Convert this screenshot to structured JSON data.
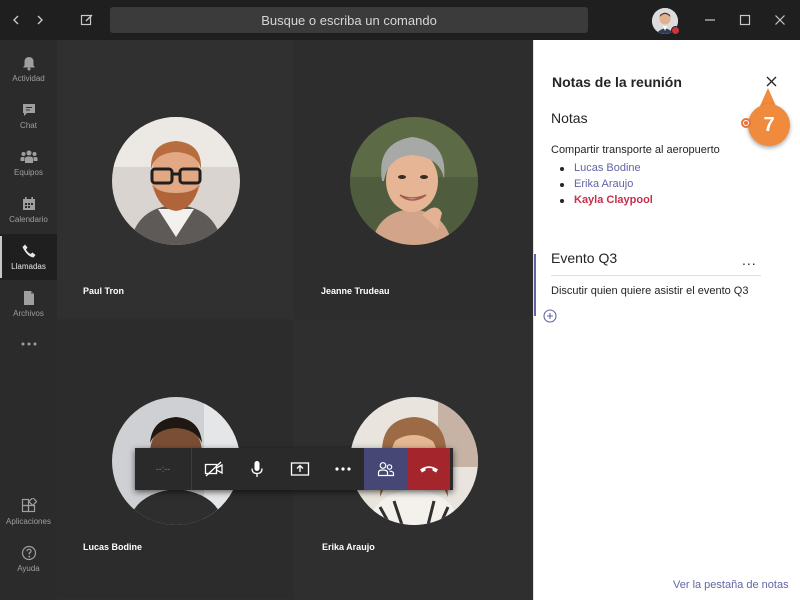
{
  "titlebar": {
    "search_placeholder": "Busque o escriba un comando",
    "back_icon": "chevron-left-icon",
    "forward_icon": "chevron-right-icon",
    "compose_icon": "compose-icon",
    "presence_color": "#d13438"
  },
  "rail": {
    "items": [
      {
        "label": "Actividad",
        "icon": "bell-icon"
      },
      {
        "label": "Chat",
        "icon": "chat-icon"
      },
      {
        "label": "Equipos",
        "icon": "teams-icon"
      },
      {
        "label": "Calendario",
        "icon": "calendar-icon"
      },
      {
        "label": "Llamadas",
        "icon": "phone-icon",
        "active": true
      },
      {
        "label": "Archivos",
        "icon": "file-icon"
      },
      {
        "label": "",
        "icon": "more-icon"
      },
      {
        "label": "Aplicaciones",
        "icon": "apps-icon"
      },
      {
        "label": "Ayuda",
        "icon": "help-icon"
      }
    ]
  },
  "participants": [
    {
      "name": "Paul Tron"
    },
    {
      "name": "Jeanne Trudeau"
    },
    {
      "name": "Lucas Bodine"
    },
    {
      "name": "Erika Araujo"
    }
  ],
  "controls": {
    "timer": "--:--",
    "buttons": [
      "video-off-icon",
      "mic-icon",
      "share-screen-icon",
      "more-icon",
      "participants-icon",
      "hang-up-icon"
    ],
    "hangup_color": "#a4262c",
    "people_color": "#464775"
  },
  "panel": {
    "title": "Notas de la reunión",
    "section1": {
      "heading": "Notas",
      "line": "Compartir transporte al aeropuerto",
      "bullets": [
        "Lucas Bodine",
        "Erika Araujo",
        "Kayla Claypool"
      ]
    },
    "section2": {
      "heading": "Evento Q3",
      "more": "...",
      "text": "Discutir quien quiere asistir el evento Q3"
    },
    "footer_link": "Ver la pestaña de notas"
  },
  "callout": {
    "step": "7",
    "color": "#f08a3d"
  }
}
